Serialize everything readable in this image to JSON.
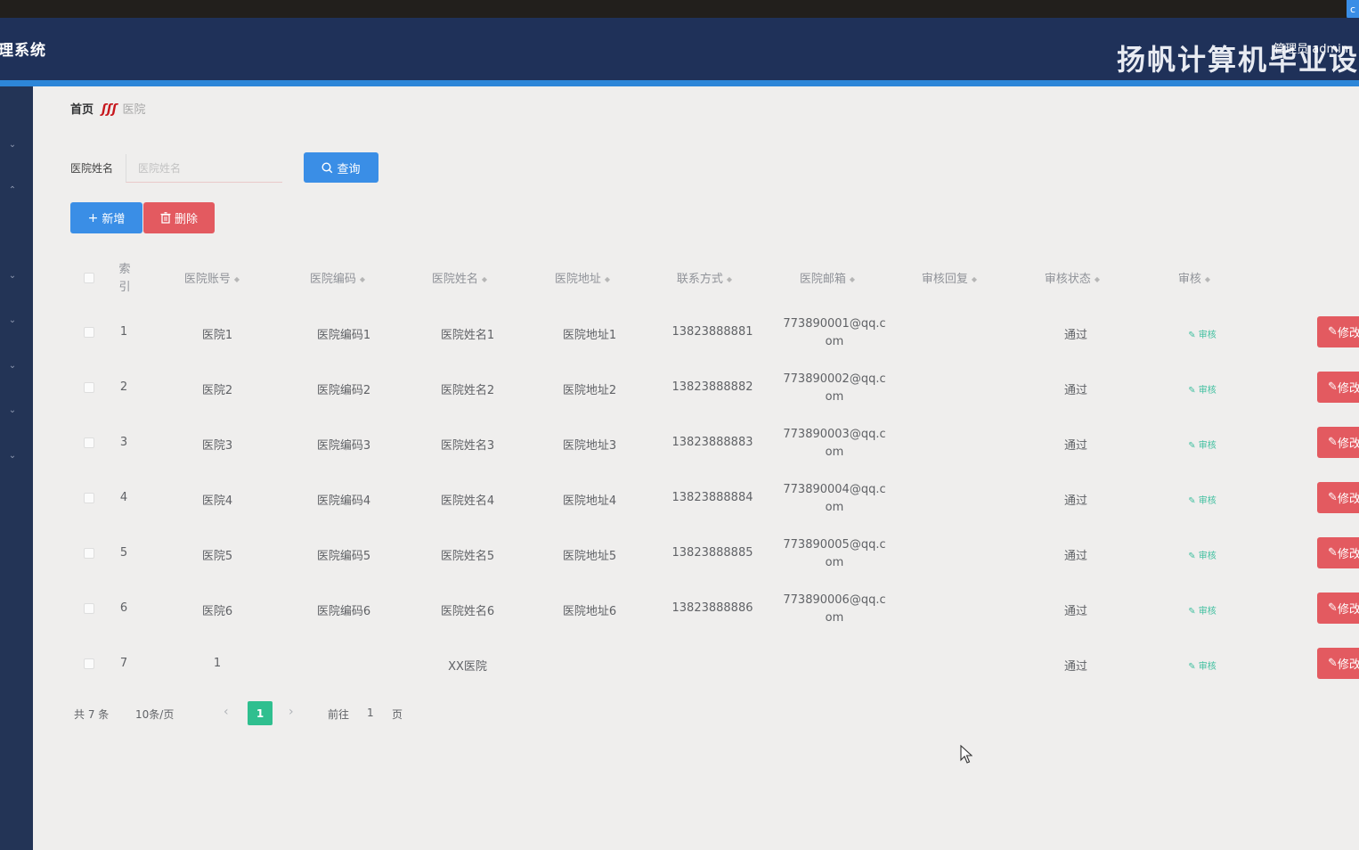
{
  "header": {
    "app_title": "理系统",
    "banner": "扬帆计算机毕业设",
    "user_label": "管理员 admin",
    "corner_badge": "c"
  },
  "breadcrumb": {
    "home": "首页",
    "separator": "ʃʃʃ",
    "current": "医院"
  },
  "search": {
    "label": "医院姓名",
    "placeholder": "医院姓名",
    "query_button": "查询"
  },
  "actions": {
    "add_button": "新增",
    "delete_button": "删除"
  },
  "table": {
    "headers": {
      "index": "索引",
      "account": "医院账号",
      "code": "医院编码",
      "name": "医院姓名",
      "address": "医院地址",
      "phone": "联系方式",
      "email": "医院邮箱",
      "reply": "审核回复",
      "status": "审核状态",
      "audit": "审核"
    },
    "rows": [
      {
        "index": "1",
        "account": "医院1",
        "code": "医院编码1",
        "name": "医院姓名1",
        "address": "医院地址1",
        "phone": "13823888881",
        "email_line1": "773890001@qq.c",
        "email_line2": "om",
        "reply": "",
        "status": "通过",
        "audit": "审核",
        "edit": "修改"
      },
      {
        "index": "2",
        "account": "医院2",
        "code": "医院编码2",
        "name": "医院姓名2",
        "address": "医院地址2",
        "phone": "13823888882",
        "email_line1": "773890002@qq.c",
        "email_line2": "om",
        "reply": "",
        "status": "通过",
        "audit": "审核",
        "edit": "修改"
      },
      {
        "index": "3",
        "account": "医院3",
        "code": "医院编码3",
        "name": "医院姓名3",
        "address": "医院地址3",
        "phone": "13823888883",
        "email_line1": "773890003@qq.c",
        "email_line2": "om",
        "reply": "",
        "status": "通过",
        "audit": "审核",
        "edit": "修改"
      },
      {
        "index": "4",
        "account": "医院4",
        "code": "医院编码4",
        "name": "医院姓名4",
        "address": "医院地址4",
        "phone": "13823888884",
        "email_line1": "773890004@qq.c",
        "email_line2": "om",
        "reply": "",
        "status": "通过",
        "audit": "审核",
        "edit": "修改"
      },
      {
        "index": "5",
        "account": "医院5",
        "code": "医院编码5",
        "name": "医院姓名5",
        "address": "医院地址5",
        "phone": "13823888885",
        "email_line1": "773890005@qq.c",
        "email_line2": "om",
        "reply": "",
        "status": "通过",
        "audit": "审核",
        "edit": "修改"
      },
      {
        "index": "6",
        "account": "医院6",
        "code": "医院编码6",
        "name": "医院姓名6",
        "address": "医院地址6",
        "phone": "13823888886",
        "email_line1": "773890006@qq.c",
        "email_line2": "om",
        "reply": "",
        "status": "通过",
        "audit": "审核",
        "edit": "修改"
      },
      {
        "index": "7",
        "account": "1",
        "code": "",
        "name": "XX医院",
        "address": "",
        "phone": "",
        "email_line1": "",
        "email_line2": "",
        "reply": "",
        "status": "通过",
        "audit": "审核",
        "edit": "修改"
      }
    ]
  },
  "pagination": {
    "total": "共 7 条",
    "page_size": "10条/页",
    "current_page": "1",
    "goto_label": "前往",
    "goto_value": "1",
    "page_suffix": "页"
  },
  "colors": {
    "header_bg": "#1f3159",
    "sidebar_bg": "#233456",
    "primary": "#3a8ee6",
    "danger": "#e35a60",
    "success": "#2fbf8f"
  }
}
